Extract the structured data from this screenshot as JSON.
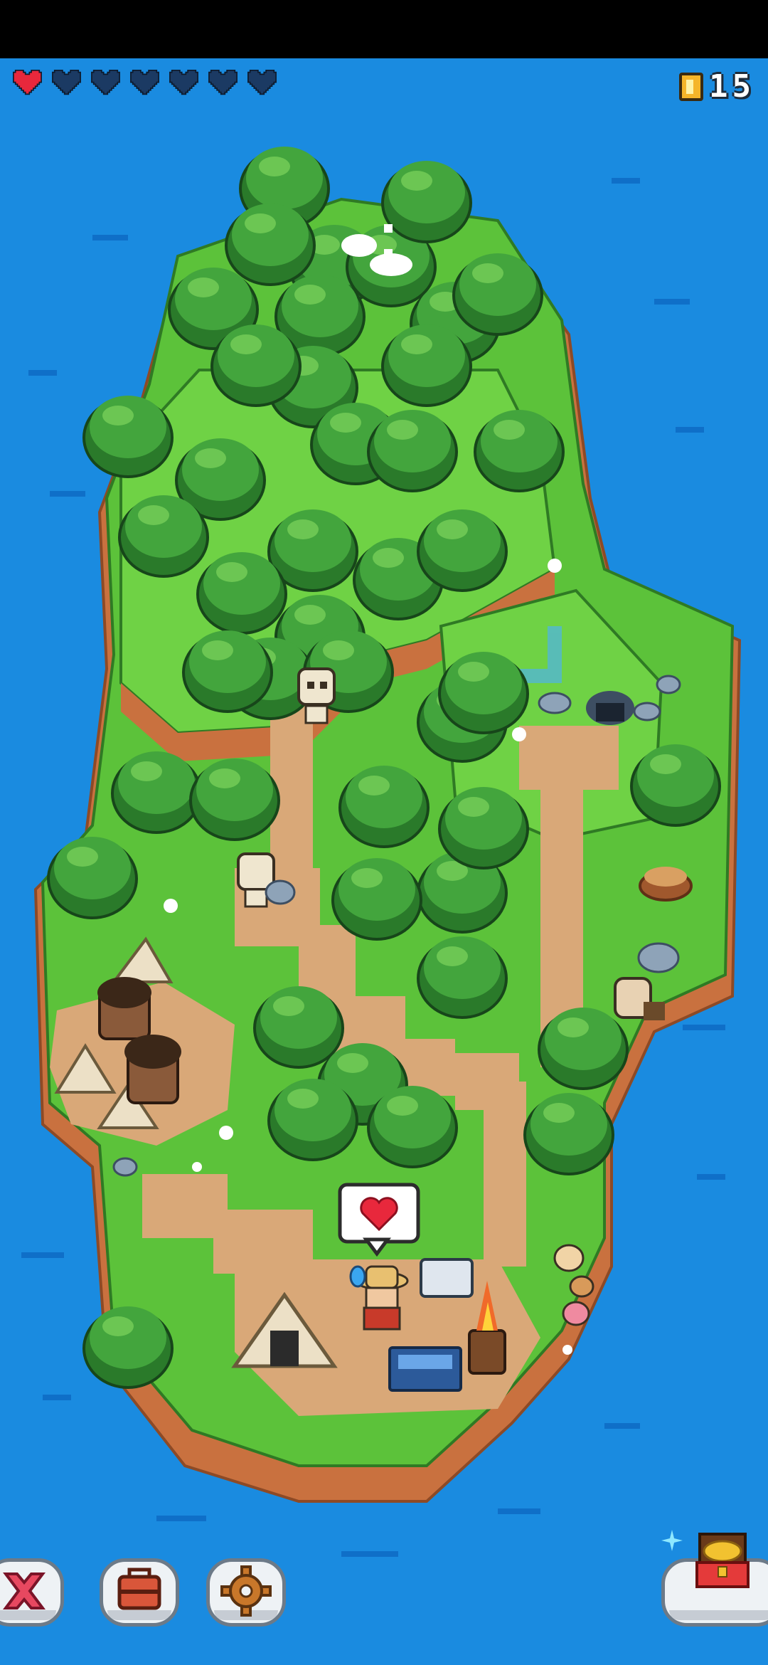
{
  "hud": {
    "hearts_total": 7,
    "hearts_filled": 1,
    "heart_full_color": "#e8283c",
    "heart_empty_color": "#1b3a63",
    "coins": "15",
    "coin_icon": "coin-icon"
  },
  "speech_bubble": {
    "icon": "heart-icon",
    "color": "#e8283c"
  },
  "toolbar": {
    "buttons": [
      {
        "name": "close-button",
        "icon": "close-icon",
        "color": "#e74860"
      },
      {
        "name": "inventory-button",
        "icon": "toolbox-icon",
        "color": "#d9563a"
      },
      {
        "name": "settings-button",
        "icon": "gear-icon",
        "color": "#c8772a"
      },
      {
        "name": "treasure-button",
        "icon": "treasure-chest-icon",
        "color": "#f2c230"
      }
    ]
  },
  "colors": {
    "sea": "#1a8be0",
    "grass": "#5cc23a",
    "cliff": "#c9713f",
    "path": "#d9a878",
    "tree": "#3a9a3a"
  }
}
